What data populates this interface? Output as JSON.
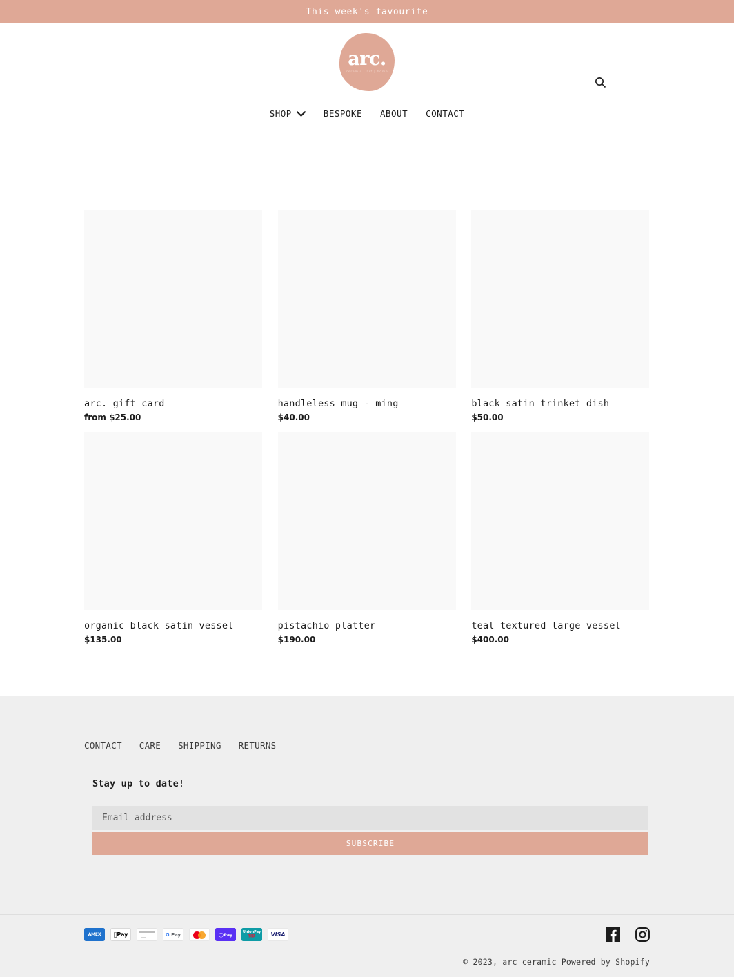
{
  "announcement": {
    "text": "This week's favourite"
  },
  "header": {
    "logo": {
      "mark": "arc.",
      "subtitle": "ceramic | art | home"
    },
    "search_icon": "search-icon"
  },
  "nav": {
    "items": [
      {
        "label": "SHOP",
        "has_chevron": true
      },
      {
        "label": "BESPOKE",
        "has_chevron": false
      },
      {
        "label": "ABOUT",
        "has_chevron": false
      },
      {
        "label": "CONTACT",
        "has_chevron": false
      }
    ]
  },
  "products": [
    {
      "title": "arc. gift card",
      "price": "from $25.00"
    },
    {
      "title": "handleless mug - ming",
      "price": "$40.00"
    },
    {
      "title": "black satin trinket dish",
      "price": "$50.00"
    },
    {
      "title": "organic black satin vessel",
      "price": "$135.00"
    },
    {
      "title": "pistachio platter",
      "price": "$190.00"
    },
    {
      "title": "teal textured large vessel",
      "price": "$400.00"
    }
  ],
  "footer": {
    "nav": [
      {
        "label": "CONTACT"
      },
      {
        "label": "CARE"
      },
      {
        "label": "SHIPPING"
      },
      {
        "label": "RETURNS"
      }
    ],
    "newsletter": {
      "title": "Stay up to date!",
      "email_placeholder": "Email address",
      "email_value": "",
      "subscribe_label": "SUBSCRIBE"
    },
    "payments": [
      {
        "name": "amex",
        "label": "AMEX"
      },
      {
        "name": "apple-pay",
        "label": "Pay"
      },
      {
        "name": "generic-card",
        "label": ""
      },
      {
        "name": "google-pay",
        "label": "Pay"
      },
      {
        "name": "mastercard",
        "label": ""
      },
      {
        "name": "shop-pay",
        "label": "Pay"
      },
      {
        "name": "unionpay",
        "label": "UnionPay"
      },
      {
        "name": "visa",
        "label": "VISA"
      }
    ],
    "socials": [
      {
        "name": "facebook"
      },
      {
        "name": "instagram"
      }
    ],
    "copyright": "© 2023, arc ceramic",
    "powered_by": "Powered by Shopify"
  },
  "colors": {
    "accent": "#dfa896",
    "footer_bg": "#efefef",
    "placeholder_bg": "#f9f9f9",
    "input_bg": "#e2e2e2"
  }
}
